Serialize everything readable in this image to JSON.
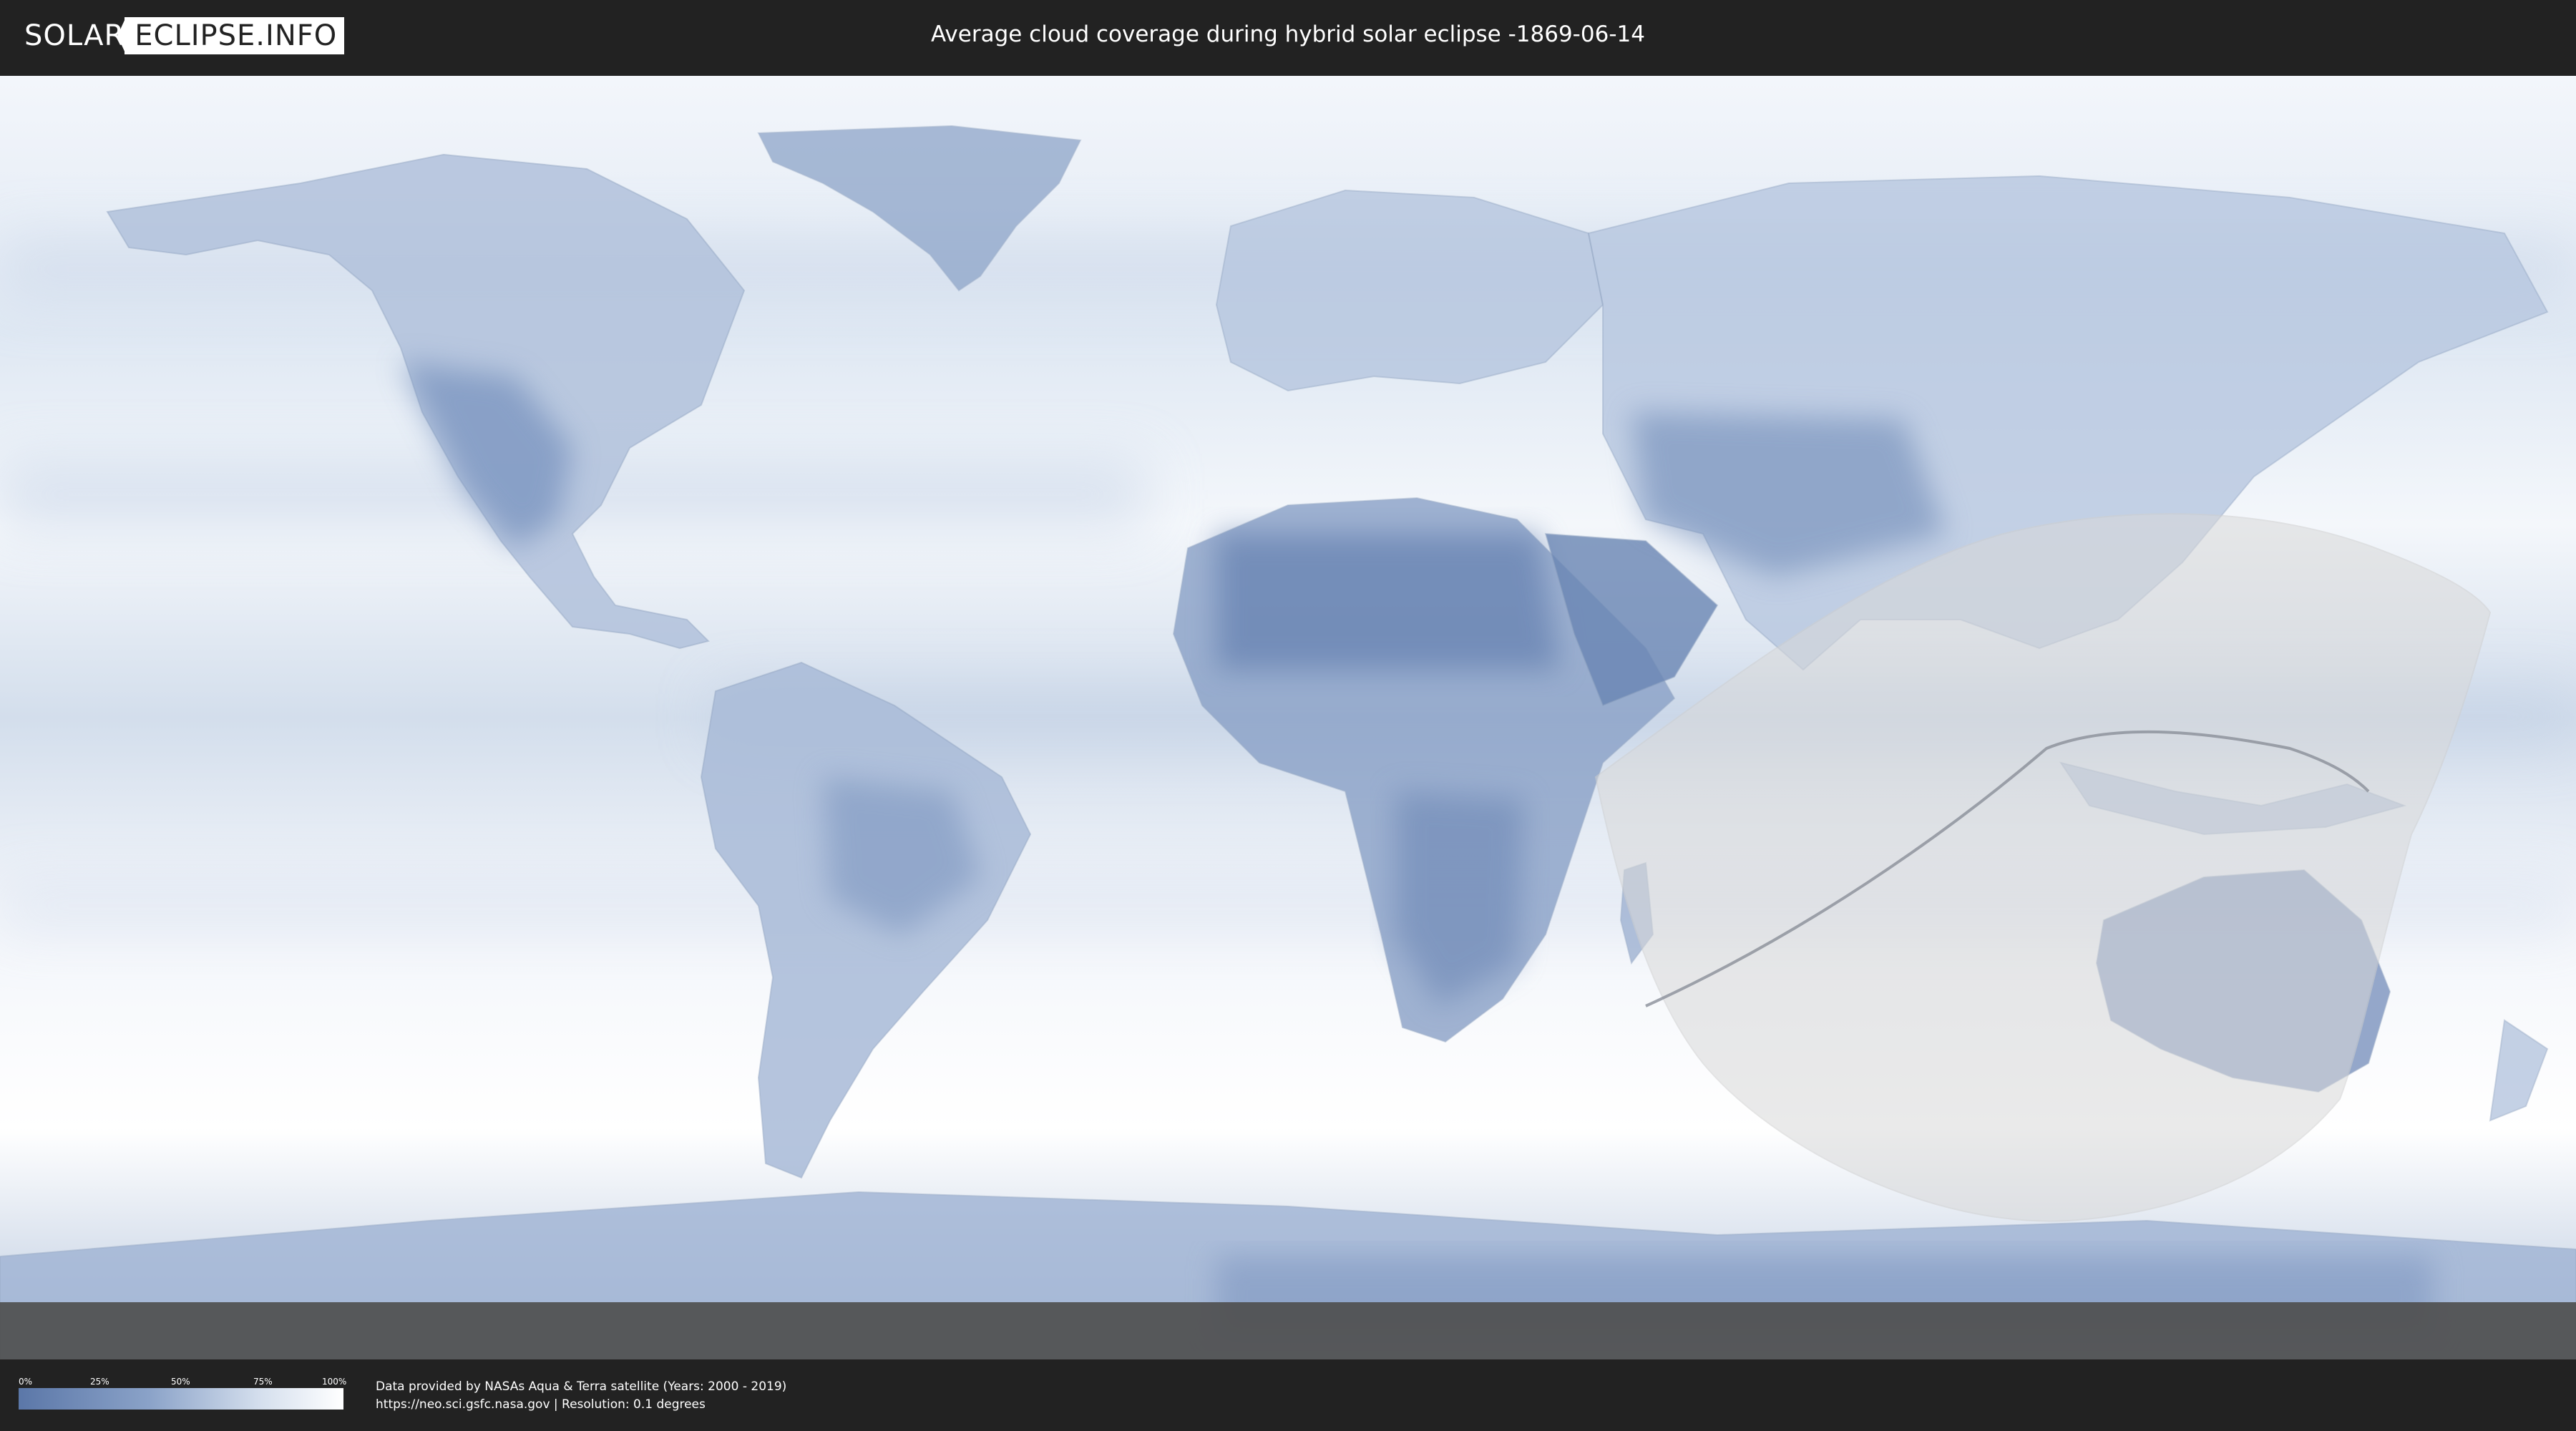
{
  "header": {
    "logo_left": "SOLAR",
    "logo_right": "ECLIPSE.INFO",
    "title": "Average cloud coverage during hybrid solar eclipse -1869-06-14"
  },
  "map": {
    "ocean_color": "#e9eff7",
    "land_dark_color": "#6b86b4",
    "shadow_color": "#d9d9d9"
  },
  "legend": {
    "ticks": [
      "0%",
      "25%",
      "50%",
      "75%",
      "100%"
    ],
    "colors": [
      "#5b77a8",
      "#ffffff"
    ]
  },
  "credits": {
    "line1": "Data provided by NASAs Aqua & Terra satellite (Years: 2000 - 2019)",
    "line2": "https://neo.sci.gsfc.nasa.gov | Resolution: 0.1 degrees"
  }
}
